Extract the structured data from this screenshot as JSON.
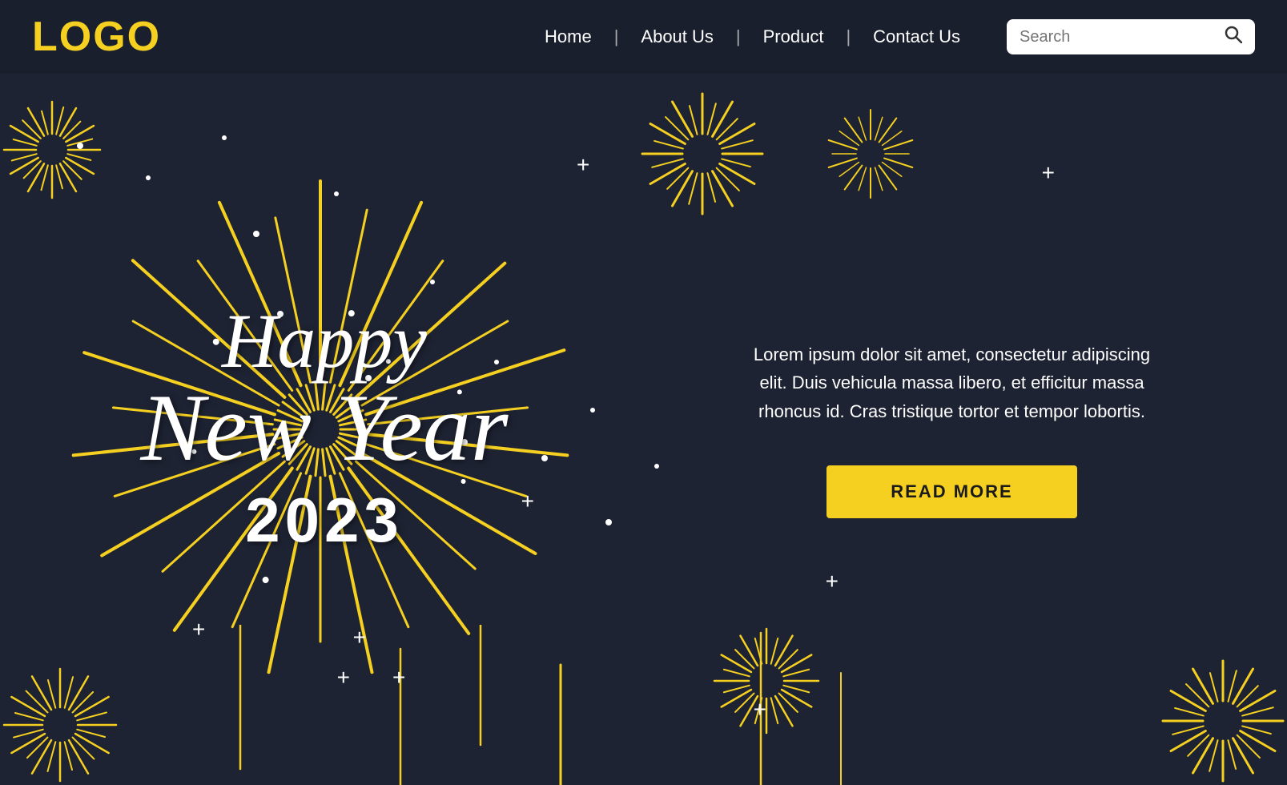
{
  "navbar": {
    "logo": "LOGO",
    "links": [
      {
        "label": "Home",
        "id": "home"
      },
      {
        "label": "About Us",
        "id": "about"
      },
      {
        "label": "Product",
        "id": "product"
      },
      {
        "label": "Contact Us",
        "id": "contact"
      }
    ],
    "search": {
      "placeholder": "Search",
      "button_label": "🔍"
    }
  },
  "hero": {
    "line1": "Happy",
    "line2": "New Year",
    "line3": "2023",
    "description": "Lorem ipsum dolor sit amet, consectetur adipiscing elit. Duis vehicula massa libero, et efficitur massa rhoncus id. Cras tristique tortor et tempor lobortis.",
    "cta_label": "READ MORE"
  },
  "colors": {
    "gold": "#f5d020",
    "bg": "#1e2333",
    "white": "#ffffff"
  }
}
